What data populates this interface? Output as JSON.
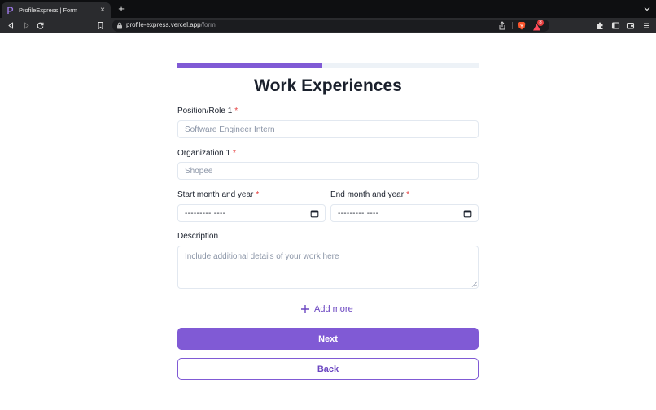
{
  "browser": {
    "tab_title": "ProfileExpress | Form",
    "url_host": "profile-express.vercel.app",
    "url_path": "/form",
    "rewards_badge": "8"
  },
  "form": {
    "progress_percent": 48,
    "title": "Work Experiences",
    "required_marker": "*",
    "position_label": "Position/Role 1",
    "position_placeholder": "Software Engineer Intern",
    "organization_label": "Organization 1",
    "organization_placeholder": "Shopee",
    "start_label": "Start month and year",
    "end_label": "End month and year",
    "start_value": "--------- ----",
    "end_value": "--------- ----",
    "description_label": "Description",
    "description_placeholder": "Include additional details of your work here",
    "add_more_label": "Add more",
    "next_label": "Next",
    "back_label": "Back"
  },
  "colors": {
    "accent": "#805ad5",
    "accent_text": "#6b46c1",
    "required": "#e53e3e"
  },
  "icons": {
    "favicon": "profileexpress-logo-icon",
    "calendar": "calendar-icon",
    "add": "plus-icon"
  }
}
